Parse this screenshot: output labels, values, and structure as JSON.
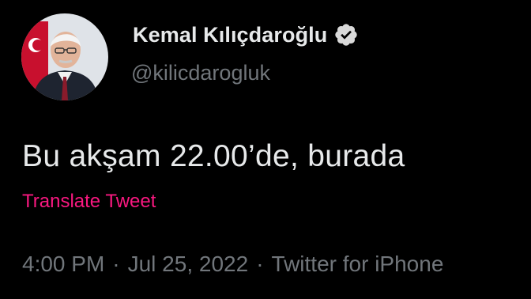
{
  "colors": {
    "background": "#000000",
    "text_primary": "#e7e9ea",
    "text_secondary": "#71767b",
    "translate_link": "#f91880",
    "verified_badge": "#d9d9d9"
  },
  "author": {
    "display_name": "Kemal Kılıçdaroğlu",
    "handle": "@kilicdarogluk",
    "verified_icon": "verified-badge-icon",
    "avatar_icon": "profile-photo"
  },
  "tweet": {
    "text": "Bu akşam 22.00’de, burada",
    "translate_label": "Translate Tweet"
  },
  "meta": {
    "time": "4:00 PM",
    "separator": "·",
    "date": "Jul 25, 2022",
    "source": "Twitter for iPhone"
  }
}
